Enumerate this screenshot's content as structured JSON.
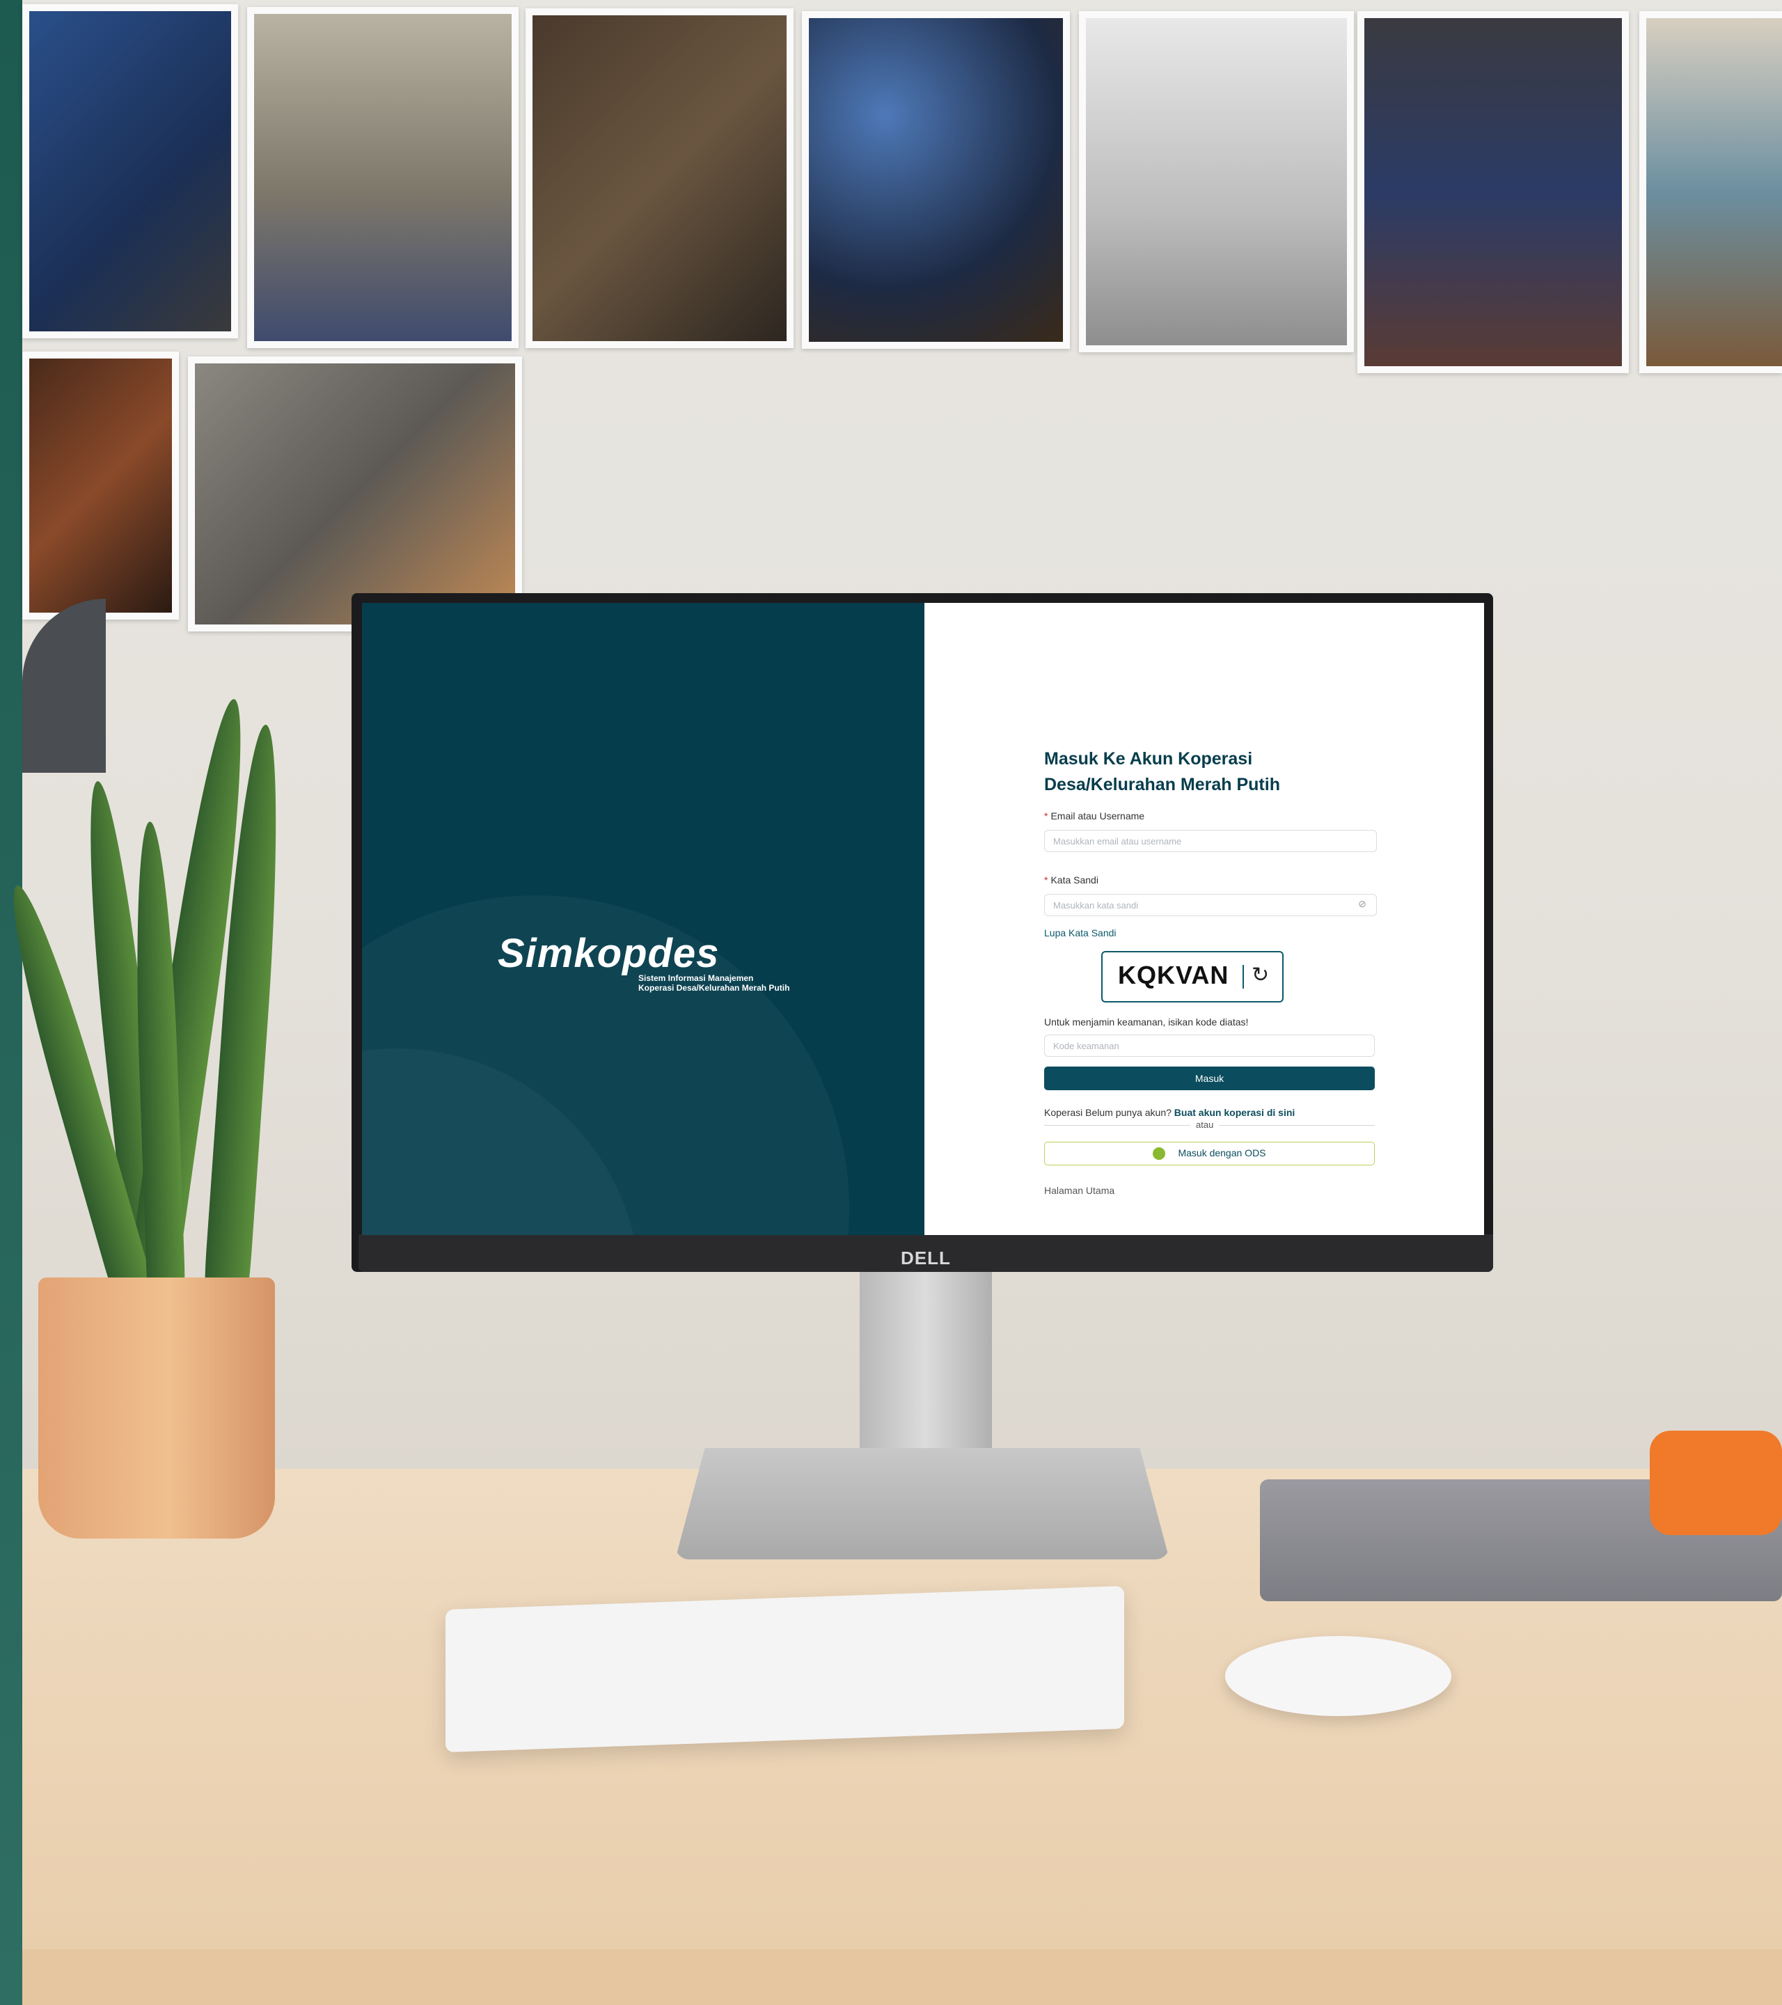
{
  "brand": {
    "name": "Simkopdes",
    "subtitle_line1": "Sistem Informasi Manajemen",
    "subtitle_line2": "Koperasi Desa/Kelurahan Merah Putih"
  },
  "login": {
    "title_line1": "Masuk Ke Akun Koperasi",
    "title_line2": "Desa/Kelurahan Merah Putih",
    "email": {
      "label": "Email atau Username",
      "placeholder": "Masukkan email atau username"
    },
    "password": {
      "label": "Kata Sandi",
      "placeholder": "Masukkan kata sandi"
    },
    "forgot_password": "Lupa Kata Sandi",
    "captcha": {
      "code": "KQKVAN",
      "refresh_icon": "refresh-icon"
    },
    "security_hint": "Untuk menjamin keamanan, isikan kode diatas!",
    "security_code": {
      "placeholder": "Kode keamanan"
    },
    "submit_label": "Masuk",
    "no_account_text": "Koperasi Belum punya akun?",
    "register_link": "Buat akun koperasi di sini",
    "or_text": "atau",
    "ods_button": "Masuk dengan ODS",
    "home_link": "Halaman Utama"
  },
  "monitor": {
    "brand": "DELL"
  },
  "colors": {
    "brand_panel": "#063d4c",
    "primary_button": "#0b4d5e",
    "ods_border": "#b9d15a",
    "required": "#d62828"
  }
}
